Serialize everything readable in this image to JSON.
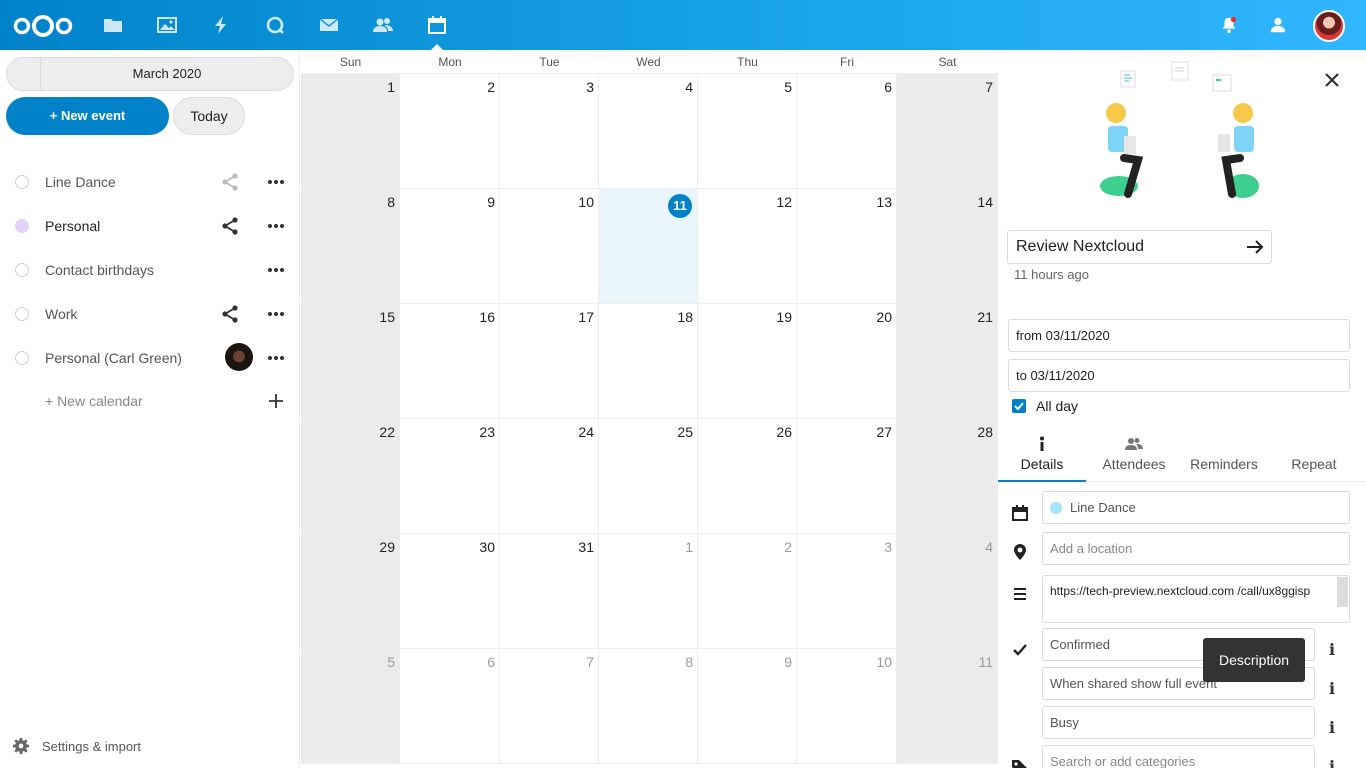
{
  "header": {
    "apps": [
      "files-icon",
      "photos-icon",
      "activity-icon",
      "talk-icon",
      "mail-icon",
      "contacts-icon",
      "calendar-icon"
    ],
    "active_app": "calendar-icon",
    "accent": "#0082c9"
  },
  "sidebar": {
    "month_label": "March 2020",
    "new_event_label": "+ New event",
    "today_label": "Today",
    "calendars": [
      {
        "name": "Line Dance",
        "shared": true,
        "enabled": false
      },
      {
        "name": "Personal",
        "shared": true,
        "enabled": true,
        "color": "#e3d4f7"
      },
      {
        "name": "Contact birthdays",
        "shared": false,
        "enabled": false
      },
      {
        "name": "Work",
        "shared": true,
        "enabled": false
      },
      {
        "name": "Personal (Carl Green)",
        "shared": false,
        "enabled": false
      }
    ],
    "new_calendar_label": "+ New calendar",
    "settings_label": "Settings & import"
  },
  "grid": {
    "weekdays": [
      "Sun",
      "Mon",
      "Tue",
      "Wed",
      "Thu",
      "Fri",
      "Sat"
    ],
    "weeks": [
      [
        "1",
        "2",
        "3",
        "4",
        "5",
        "6",
        "7"
      ],
      [
        "8",
        "9",
        "10",
        "11",
        "12",
        "13",
        "14"
      ],
      [
        "15",
        "16",
        "17",
        "18",
        "19",
        "20",
        "21"
      ],
      [
        "22",
        "23",
        "24",
        "25",
        "26",
        "27",
        "28"
      ],
      [
        "29",
        "30",
        "31",
        "1",
        "2",
        "3",
        "4"
      ],
      [
        "5",
        "6",
        "7",
        "8",
        "9",
        "10",
        "11"
      ]
    ],
    "today": "11"
  },
  "details": {
    "title": "Review Nextcloud",
    "modified": "11 hours ago",
    "from": "from 03/11/2020",
    "to": "to 03/11/2020",
    "all_day_label": "All day",
    "tabs": [
      "Details",
      "Attendees",
      "Reminders",
      "Repeat"
    ],
    "calendar": "Line Dance",
    "location_placeholder": "Add a location",
    "description": "https://tech-preview.nextcloud.com /call/ux8ggisp",
    "status": "Confirmed",
    "visibility": "When shared show full event",
    "availability": "Busy",
    "categories_placeholder": "Search or add categories",
    "info_glyph": "i",
    "tooltip": "Description"
  }
}
